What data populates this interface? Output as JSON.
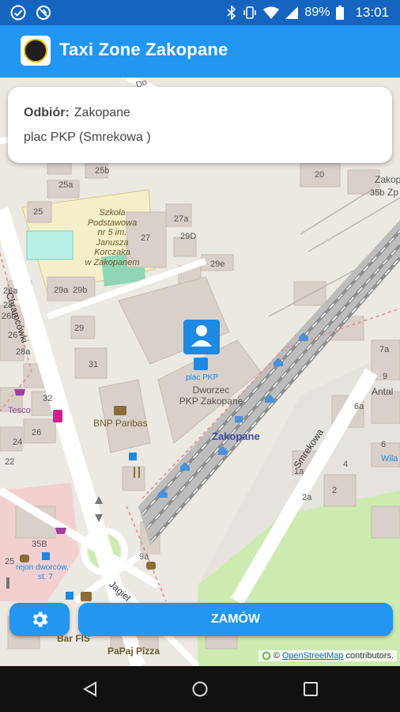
{
  "status_bar": {
    "battery": "89%",
    "time": "13:01",
    "left_icons": [
      "check-circle-icon",
      "no-sync-icon"
    ],
    "right_icons": [
      "bluetooth-icon",
      "vibrate-icon",
      "wifi-icon",
      "signal-icon",
      "battery-icon"
    ]
  },
  "app_bar": {
    "title": "Taxi Zone Zakopane",
    "logo_icon": "taxi-logo-icon"
  },
  "pickup_card": {
    "label": "Odbiór:",
    "city": "Zakopane",
    "address": "plac PKP (Smrekowa )"
  },
  "map": {
    "labels": {
      "school": [
        "Szkoła",
        "Podstawowa",
        "nr 5 im.",
        "Janusza",
        "Korczaka",
        "w Zakopanem"
      ],
      "street_chramcowki": "Chramcówki",
      "street_smrekowa": "Smrekowa",
      "street_jagiel": "Jagiel",
      "station": [
        "Dworzec",
        "PKP Zakopane"
      ],
      "marker_label": "plac PKP",
      "zakopane": "Zakopane",
      "tesco": "Tesco",
      "bnp": "BNP Paribas",
      "rejon": [
        "rejon dworców,",
        "st. 7"
      ],
      "bar_fis": "Bar FIS",
      "papaj": "PaPaj Pizza",
      "antal": "Antal",
      "wila": "Wila",
      "zakop": "Zakop",
      "zp": "Zp",
      "do_a": "Do",
      "house_numbers": [
        "25b",
        "25a",
        "25",
        "27a",
        "27",
        "29D",
        "29e",
        "29a",
        "29b",
        "29",
        "31",
        "20",
        "35b",
        "26a",
        "26b",
        "26",
        "28",
        "28a",
        "32",
        "26",
        "24",
        "22",
        "1a",
        "2",
        "2a",
        "4",
        "6",
        "6a",
        "7a",
        "9",
        "9a",
        "35B",
        "25",
        "22",
        "1"
      ]
    },
    "attribution": {
      "prefix": "©",
      "link": "OpenStreetMap",
      "suffix": "contributors."
    }
  },
  "buttons": {
    "settings_icon": "gear-icon",
    "order_label": "ZAMÓW"
  },
  "nav_bar": {
    "back_icon": "back-icon",
    "home_icon": "home-icon",
    "recents_icon": "recents-icon"
  },
  "colors": {
    "status_bar": "#1565c0",
    "app_bar": "#2196f3",
    "button": "#2196f3",
    "map_background": "#ece8e2",
    "railway": "#9e9e9e"
  }
}
